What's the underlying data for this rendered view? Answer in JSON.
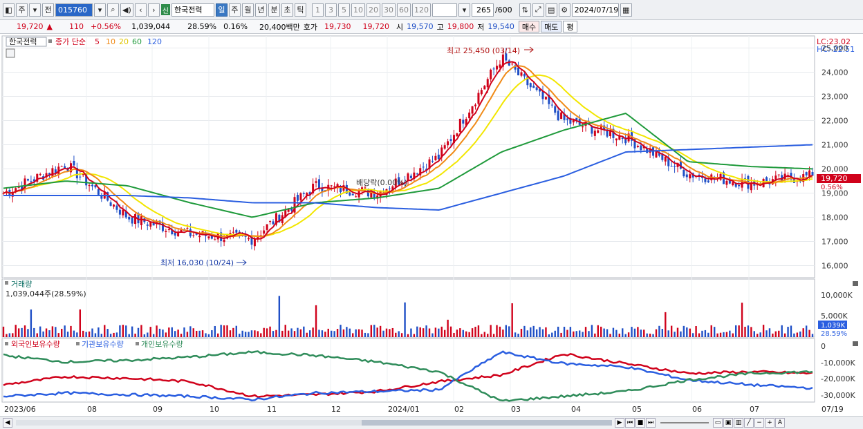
{
  "toolbar": {
    "type_label": "주",
    "type_label2": "전",
    "code": "015760",
    "sin_badge": "신",
    "stock_name": "한국전력",
    "periods": [
      "일",
      "주",
      "월",
      "년",
      "분",
      "초",
      "틱"
    ],
    "selected_period": "일",
    "intervals": [
      "1",
      "3",
      "5",
      "10",
      "20",
      "30",
      "60",
      "120"
    ],
    "count": "265",
    "count_max": "/600",
    "date": "2024/07/19"
  },
  "quote": {
    "price": "19,720",
    "arrow": "▲",
    "change": "110",
    "change_pct": "+0.56%",
    "volume": "1,039,044",
    "turnover": "28.59%",
    "ratio": "0.16%",
    "amount": "20,400백만",
    "bid_label": "호가",
    "bid1": "19,730",
    "bid2": "19,720",
    "open_label": "시",
    "open": "19,570",
    "high_label": "고",
    "high": "19,800",
    "low_label": "저",
    "low": "19,540",
    "buy_label": "매수",
    "sell_label": "매도",
    "eval_label": "평"
  },
  "price_panel": {
    "legend_name": "한국전력",
    "legend_ma_label": "종가 단순",
    "ma_periods": [
      "5",
      "10",
      "20",
      "60",
      "120"
    ],
    "ma_colors": [
      "#d0021b",
      "#f08a16",
      "#f2e600",
      "#1f9a3b",
      "#2a5ee0"
    ],
    "lc": "LC:23.02",
    "hc": "HC:-22.51",
    "high_note": "최고 25,450 (03/14)",
    "low_note": "최저 16,030 (10/24)",
    "dividend_note": "배당락(0.00%)",
    "current_tag": "19,720",
    "current_pct": "0.56%",
    "y_ticks": [
      "25,000",
      "24,000",
      "23,000",
      "22,000",
      "21,000",
      "20,000",
      "19,000",
      "18,000",
      "17,000",
      "16,000"
    ]
  },
  "volume_panel": {
    "title": "거래량",
    "value": "1,039,044주(28.59%)",
    "y_ticks": [
      "10,000K",
      "5,000K"
    ],
    "tag1": "1,039K",
    "tag2": "28.59%"
  },
  "holding_panel": {
    "legend": [
      "외국인보유수량",
      "기관보유수량",
      "개인보유수량"
    ],
    "colors": [
      "#d0021b",
      "#2a5ee0",
      "#2f8c5a"
    ],
    "y_ticks": [
      "0",
      "-10,000K",
      "-20,000K",
      "-30,000K"
    ]
  },
  "x_labels": [
    "2023/06",
    "08",
    "09",
    "10",
    "11",
    "12",
    "2024/01",
    "02",
    "03",
    "04",
    "05",
    "06",
    "07",
    "07/19"
  ],
  "colors": {
    "up": "#d0021b",
    "down": "#1f4fc6",
    "grid": "#e3e6ea"
  },
  "chart_data": {
    "type": "line",
    "title": "",
    "x": [
      "2023/06",
      "08",
      "09",
      "10",
      "11",
      "12",
      "2024/01",
      "02",
      "03",
      "04",
      "05",
      "06",
      "07",
      "07/19"
    ],
    "series": [
      {
        "name": "5",
        "values": [
          19000,
          20200,
          18000,
          17300,
          17100,
          19300,
          19000,
          20500,
          24600,
          22000,
          21300,
          19800,
          19400,
          19720
        ]
      },
      {
        "name": "60",
        "values": [
          19200,
          19500,
          19300,
          18600,
          18000,
          18600,
          18800,
          19200,
          20700,
          21600,
          22300,
          20300,
          20100,
          20000
        ]
      },
      {
        "name": "120",
        "values": [
          18900,
          18900,
          18900,
          18800,
          18600,
          18600,
          18400,
          18300,
          19000,
          19700,
          20700,
          20800,
          20900,
          21000
        ]
      }
    ],
    "ylim": [
      15500,
      25500
    ],
    "high": 25450,
    "low": 16030
  }
}
